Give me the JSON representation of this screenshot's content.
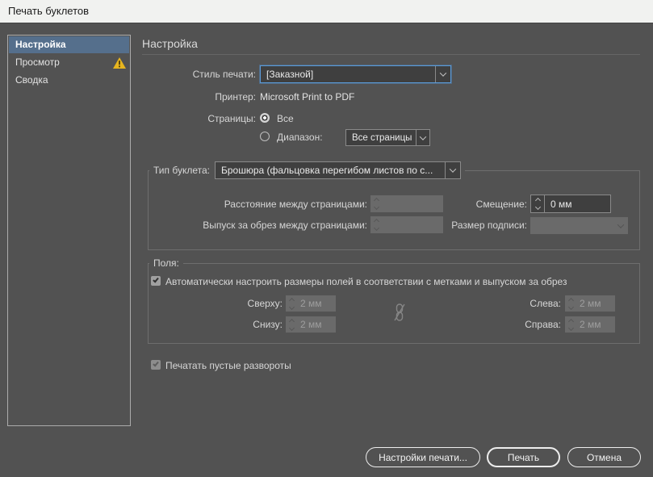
{
  "window": {
    "title": "Печать буклетов"
  },
  "sidebar": {
    "items": [
      {
        "label": "Настройка",
        "selected": true
      },
      {
        "label": "Просмотр",
        "warning": true
      },
      {
        "label": "Сводка"
      }
    ]
  },
  "main": {
    "heading": "Настройка",
    "print_style": {
      "label": "Стиль печати:",
      "value": "[Заказной]"
    },
    "printer": {
      "label": "Принтер:",
      "value": "Microsoft Print to PDF"
    },
    "pages": {
      "label": "Страницы:",
      "all_label": "Все",
      "all_selected": true,
      "range_label": "Диапазон:",
      "range_value": "Все страницы"
    },
    "booklet": {
      "legend": "Тип буклета:",
      "type_value": "Брошюра (фальцовка перегибом листов по с...",
      "space_label": "Расстояние между страницами:",
      "space_value": "",
      "bleed_label": "Выпуск за обрез между страницами:",
      "bleed_value": "",
      "creep_label": "Смещение:",
      "creep_value": "0 мм",
      "signature_label": "Размер подписи:",
      "signature_value": ""
    },
    "margins": {
      "legend": "Поля:",
      "auto_checked": true,
      "auto_label": "Автоматически настроить размеры полей в соответствии с метками и выпуском за обрез",
      "top_label": "Сверху:",
      "top_value": "2 мм",
      "bottom_label": "Снизу:",
      "bottom_value": "2 мм",
      "left_label": "Слева:",
      "left_value": "2 мм",
      "right_label": "Справа:",
      "right_value": "2 мм"
    },
    "print_blank": {
      "label": "Печатать пустые развороты",
      "checked": true
    }
  },
  "footer": {
    "buttons": [
      {
        "label": "Настройки печати..."
      },
      {
        "label": "Печать",
        "default": true
      },
      {
        "label": "Отмена"
      }
    ]
  },
  "icons": {
    "warning": "yellow-triangle-exclamation",
    "unlink": "broken-chain",
    "dropdown": "chevron-down",
    "stepper": "chevron-up-down"
  },
  "colors": {
    "titlebar_bg": "#f1f2f0",
    "dialog_bg": "#525252",
    "selection_blue": "#556f8c",
    "focus_blue": "#5b9bd8",
    "warning_yellow": "#e7b51f",
    "field_bg": "#3f3f3f",
    "disabled_field_bg": "#6a6a6a"
  }
}
